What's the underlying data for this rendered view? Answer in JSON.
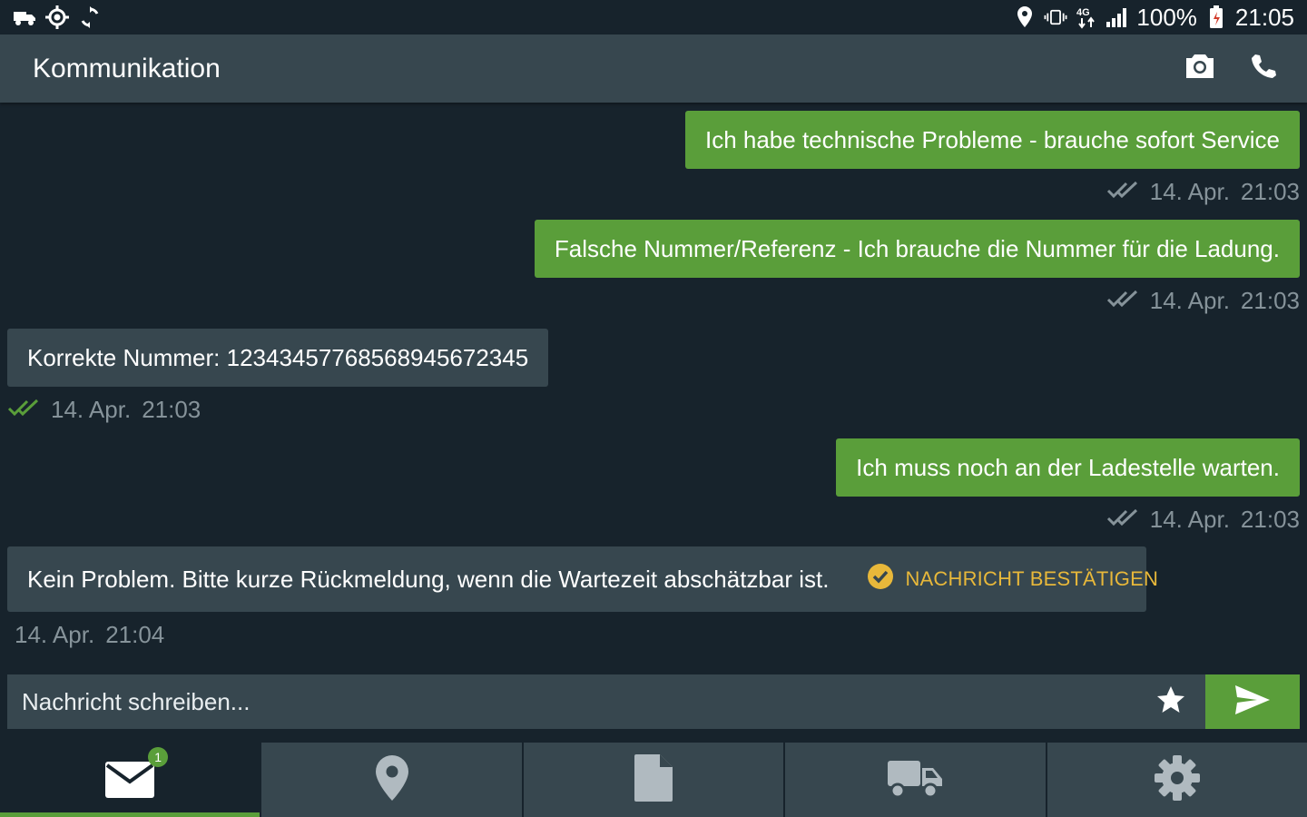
{
  "status_bar": {
    "left_icons": [
      "truck-icon",
      "gps-target-icon",
      "sync-icon"
    ],
    "right_icons": [
      "location-pin-icon",
      "vibrate-icon",
      "network-4g-icon",
      "signal-icon",
      "battery-icon"
    ],
    "battery": "100%",
    "time": "21:05"
  },
  "appbar": {
    "title": "Kommunikation",
    "actions": [
      "camera-icon",
      "phone-icon"
    ]
  },
  "messages": [
    {
      "direction": "out",
      "text": "Ich habe technische Probleme - brauche sofort Service",
      "date": "14. Apr.",
      "time": "21:03",
      "status": "delivered"
    },
    {
      "direction": "out",
      "text": "Falsche Nummer/Referenz - Ich brauche die Nummer für die Ladung.",
      "date": "14. Apr.",
      "time": "21:03",
      "status": "delivered"
    },
    {
      "direction": "in",
      "text": "Korrekte Nummer: 12343457768568945672345",
      "date": "14. Apr.",
      "time": "21:03",
      "status": "read"
    },
    {
      "direction": "out",
      "text": "Ich muss noch an der Ladestelle warten.",
      "date": "14. Apr.",
      "time": "21:03",
      "status": "delivered"
    },
    {
      "direction": "in",
      "text": "Kein Problem. Bitte kurze Rückmeldung, wenn die Wartezeit abschätzbar ist.",
      "date": "14. Apr.",
      "time": "21:04",
      "confirm_label": "NACHRICHT BESTÄTIGEN"
    }
  ],
  "composer": {
    "placeholder": "Nachricht schreiben..."
  },
  "bottom_nav": {
    "items": [
      {
        "icon": "mail-icon",
        "badge": "1",
        "active": true
      },
      {
        "icon": "map-pin-icon"
      },
      {
        "icon": "document-icon"
      },
      {
        "icon": "truck-icon"
      },
      {
        "icon": "settings-icon"
      }
    ]
  },
  "colors": {
    "background": "#17232c",
    "surface": "#37474f",
    "accent_green": "#5a9e3a",
    "confirm_yellow": "#e8b83a",
    "meta_gray": "#86939a"
  }
}
